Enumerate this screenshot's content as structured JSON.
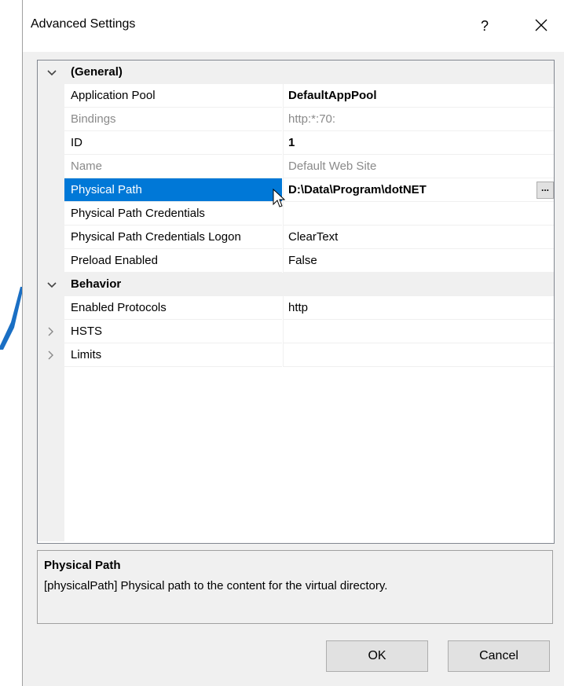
{
  "window": {
    "title": "Advanced Settings",
    "help_label": "?",
    "close_icon": "close-icon"
  },
  "grid": {
    "categories": [
      {
        "name": "(General)",
        "expanded": true,
        "properties": [
          {
            "name": "Application Pool",
            "value": "DefaultAppPool",
            "readonly": false,
            "bold": true
          },
          {
            "name": "Bindings",
            "value": "http:*:70:",
            "readonly": true,
            "bold": false
          },
          {
            "name": "ID",
            "value": "1",
            "readonly": false,
            "bold": true
          },
          {
            "name": "Name",
            "value": "Default Web Site",
            "readonly": true,
            "bold": false
          },
          {
            "name": "Physical Path",
            "value": "D:\\Data\\Program\\dotNET",
            "readonly": false,
            "bold": true,
            "selected": true,
            "ellipsis": "..."
          },
          {
            "name": "Physical Path Credentials",
            "value": "",
            "readonly": false,
            "bold": false
          },
          {
            "name": "Physical Path Credentials Logon",
            "value": "ClearText",
            "readonly": false,
            "bold": false
          },
          {
            "name": "Preload Enabled",
            "value": "False",
            "readonly": false,
            "bold": false
          }
        ]
      },
      {
        "name": "Behavior",
        "expanded": true,
        "properties": [
          {
            "name": "Enabled Protocols",
            "value": "http",
            "readonly": false,
            "bold": false
          },
          {
            "name": "HSTS",
            "value": "",
            "readonly": false,
            "bold": false,
            "collapsed": true
          },
          {
            "name": "Limits",
            "value": "",
            "readonly": false,
            "bold": false,
            "collapsed": true
          }
        ]
      }
    ]
  },
  "description": {
    "title": "Physical Path",
    "text": "[physicalPath] Physical path to the content for the virtual directory."
  },
  "buttons": {
    "ok": "OK",
    "cancel": "Cancel"
  },
  "colors": {
    "selection": "#0078d7",
    "accent_shape": "#1a6fc4"
  }
}
